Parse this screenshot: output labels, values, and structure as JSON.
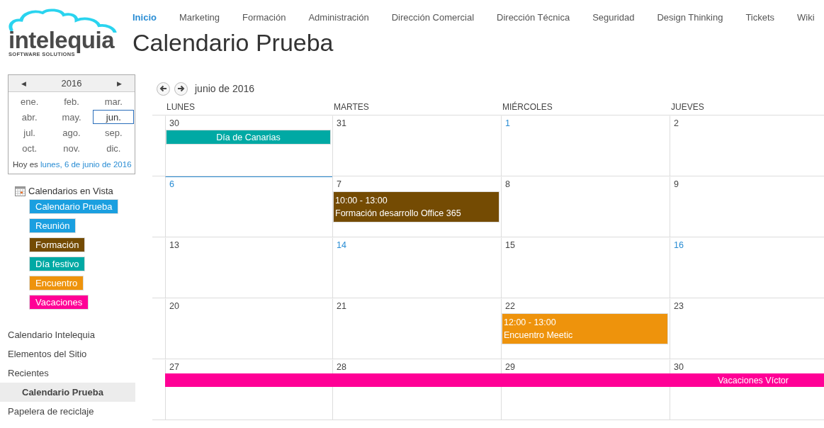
{
  "logo": {
    "name": "intelequia",
    "tagline": "SOFTWARE SOLUTIONS"
  },
  "top_nav": [
    {
      "label": "Inicio",
      "selected": true
    },
    {
      "label": "Marketing",
      "selected": false
    },
    {
      "label": "Formación",
      "selected": false
    },
    {
      "label": "Administración",
      "selected": false
    },
    {
      "label": "Dirección Comercial",
      "selected": false
    },
    {
      "label": "Dirección Técnica",
      "selected": false
    },
    {
      "label": "Seguridad",
      "selected": false
    },
    {
      "label": "Design Thinking",
      "selected": false
    },
    {
      "label": "Tickets",
      "selected": false
    },
    {
      "label": "Wiki",
      "selected": false
    }
  ],
  "page_title": "Calendario Prueba",
  "date_picker": {
    "prev": "◀",
    "year": "2016",
    "next": "▶",
    "months": [
      {
        "label": "ene.",
        "selected": false
      },
      {
        "label": "feb.",
        "selected": false
      },
      {
        "label": "mar.",
        "selected": false
      },
      {
        "label": "abr.",
        "selected": false
      },
      {
        "label": "may.",
        "selected": false
      },
      {
        "label": "jun.",
        "selected": true
      },
      {
        "label": "jul.",
        "selected": false
      },
      {
        "label": "ago.",
        "selected": false
      },
      {
        "label": "sep.",
        "selected": false
      },
      {
        "label": "oct.",
        "selected": false
      },
      {
        "label": "nov.",
        "selected": false
      },
      {
        "label": "dic.",
        "selected": false
      }
    ],
    "today_prefix": "Hoy es",
    "today_link": "lunes, 6 de junio de 2016"
  },
  "calendars_in_view": {
    "title": "Calendarios en Vista",
    "items": [
      {
        "label": "Calendario Prueba",
        "color": "#1a9fe0"
      },
      {
        "label": "Reunión",
        "color": "#1a9fe0"
      },
      {
        "label": "Formación",
        "color": "#744b03"
      },
      {
        "label": "Día festivo",
        "color": "#00a9a4"
      },
      {
        "label": "Encuentro",
        "color": "#ee930c"
      },
      {
        "label": "Vacaciones",
        "color": "#ff0096"
      }
    ]
  },
  "quick_launch": [
    {
      "label": "Calendario Intelequia",
      "selected": false
    },
    {
      "label": "Elementos del Sitio",
      "selected": false
    },
    {
      "label": "Recientes",
      "selected": false,
      "children": [
        {
          "label": "Calendario Prueba",
          "selected": true
        }
      ]
    },
    {
      "label": "Papelera de reciclaje",
      "selected": false
    }
  ],
  "calendar": {
    "month_label": "junio de 2016",
    "weekdays": [
      "LUNES",
      "MARTES",
      "MIÉRCOLES",
      "JUEVES"
    ],
    "weeks": [
      {
        "days": [
          {
            "number": "30",
            "today": false,
            "highlighted": false,
            "events": [
              {
                "kind": "allday",
                "title": "Día de Canarias",
                "color": "#00a9a4"
              }
            ]
          },
          {
            "number": "31",
            "today": false,
            "highlighted": false
          },
          {
            "number": "1",
            "today": false,
            "highlighted": true
          },
          {
            "number": "2",
            "today": false,
            "highlighted": false
          }
        ]
      },
      {
        "days": [
          {
            "number": "6",
            "today": true,
            "highlighted": true
          },
          {
            "number": "7",
            "today": false,
            "highlighted": false,
            "events": [
              {
                "kind": "timed",
                "time": "10:00 - 13:00",
                "title": "Formación desarrollo Office 365",
                "color": "#744b03"
              }
            ]
          },
          {
            "number": "8",
            "today": false,
            "highlighted": false
          },
          {
            "number": "9",
            "today": false,
            "highlighted": false
          }
        ]
      },
      {
        "days": [
          {
            "number": "13",
            "today": false,
            "highlighted": false
          },
          {
            "number": "14",
            "today": false,
            "highlighted": true
          },
          {
            "number": "15",
            "today": false,
            "highlighted": false
          },
          {
            "number": "16",
            "today": false,
            "highlighted": true
          }
        ]
      },
      {
        "days": [
          {
            "number": "20",
            "today": false,
            "highlighted": false
          },
          {
            "number": "21",
            "today": false,
            "highlighted": false
          },
          {
            "number": "22",
            "today": false,
            "highlighted": false,
            "events": [
              {
                "kind": "timed",
                "time": "12:00 - 13:00",
                "title": "Encuentro Meetic",
                "color": "#ee930c"
              }
            ]
          },
          {
            "number": "23",
            "today": false,
            "highlighted": false
          }
        ]
      },
      {
        "days": [
          {
            "number": "27",
            "today": false,
            "highlighted": false,
            "events": [
              {
                "kind": "continuing",
                "title": "Vacaciones Víctor",
                "color": "#ff0096"
              }
            ]
          },
          {
            "number": "28",
            "today": false,
            "highlighted": false
          },
          {
            "number": "29",
            "today": false,
            "highlighted": false
          },
          {
            "number": "30",
            "today": false,
            "highlighted": false
          }
        ]
      }
    ]
  }
}
